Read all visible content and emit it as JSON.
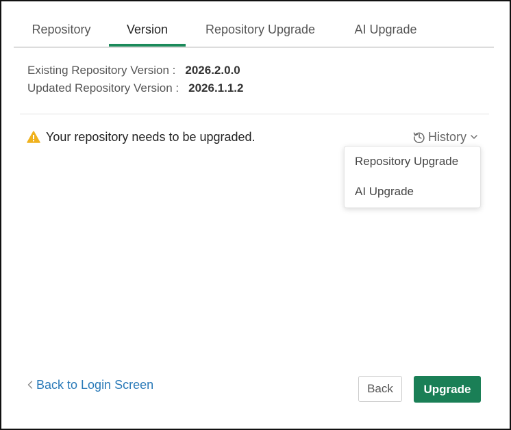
{
  "tabs": [
    {
      "label": "Repository"
    },
    {
      "label": "Version"
    },
    {
      "label": "Repository Upgrade"
    },
    {
      "label": "AI Upgrade"
    }
  ],
  "active_tab": "Version",
  "versions": {
    "existing_label": "Existing Repository Version :",
    "existing_value": "2026.2.0.0",
    "updated_label": "Updated Repository Version :",
    "updated_value": "2026.1.1.2"
  },
  "warning": {
    "icon": "warning-triangle-icon",
    "message": "Your repository needs to be upgraded."
  },
  "history": {
    "label": "History",
    "icon": "history-clock-icon",
    "menu_items": [
      {
        "label": "Repository Upgrade"
      },
      {
        "label": "AI Upgrade"
      }
    ]
  },
  "footer": {
    "back_link": "Back to Login Screen",
    "back_button": "Back",
    "upgrade_button": "Upgrade"
  },
  "colors": {
    "accent": "#1b8a5a",
    "primary_button": "#1a7f56",
    "link": "#2a7ab8",
    "warning": "#f0b21e"
  }
}
